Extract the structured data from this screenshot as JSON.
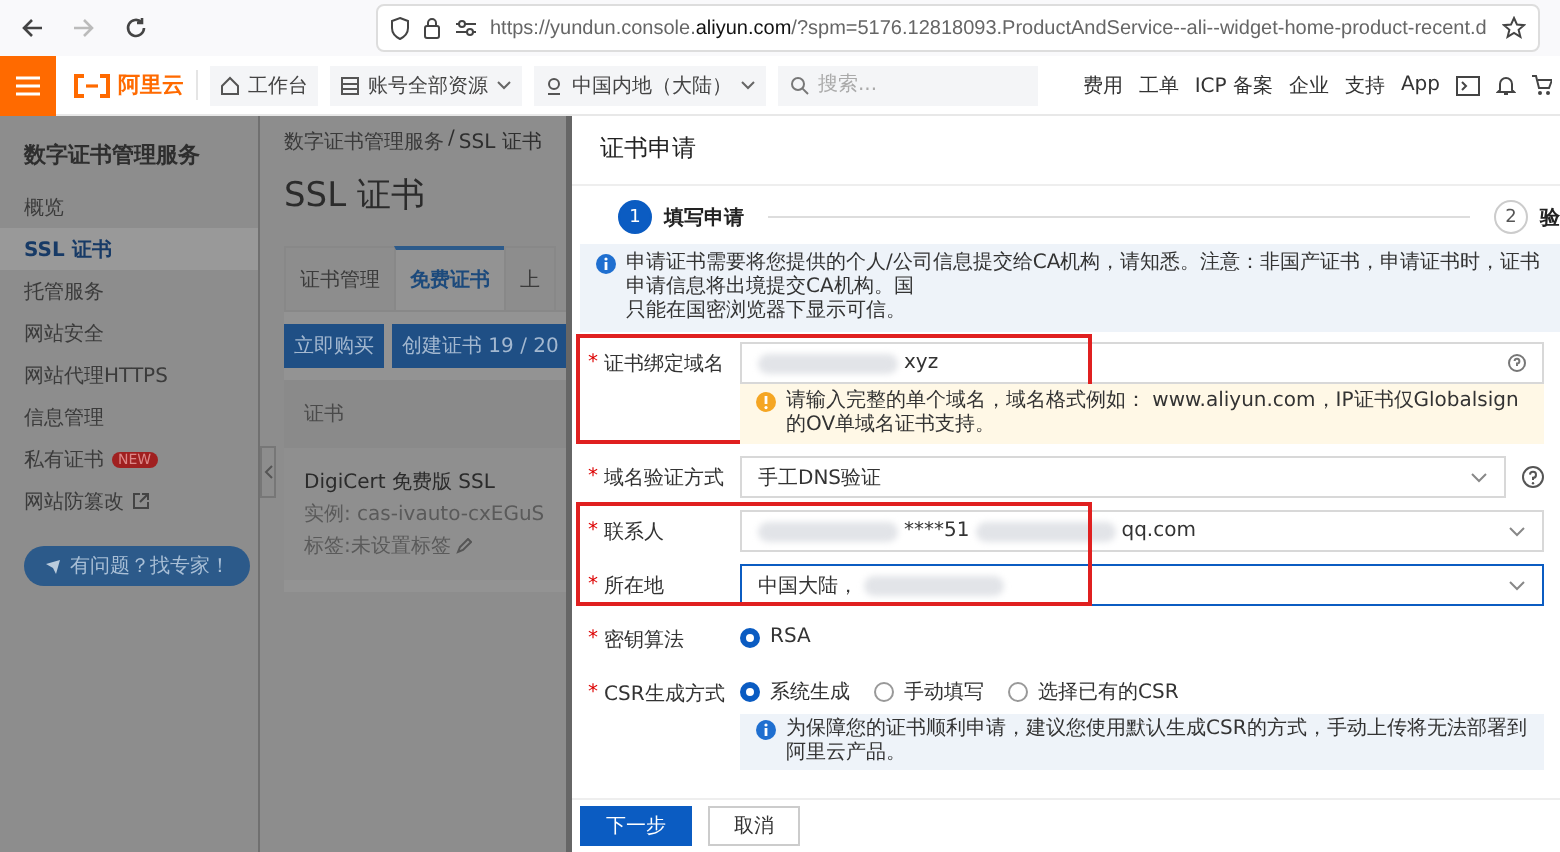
{
  "browser": {
    "url": "https://yundun.console.**aliyun.com**/?spm=5176.12818093.ProductAndService--ali--widget-home-product-recent.d"
  },
  "topnav": {
    "logo": "阿里云",
    "workbench": "工作台",
    "account": "账号全部资源",
    "region": "中国内地（大陆）",
    "search": {
      "placeholder": "搜索..."
    },
    "links": [
      "费用",
      "工单",
      "ICP 备案",
      "企业",
      "支持",
      "App"
    ]
  },
  "sidebar": {
    "title": "数字证书管理服务",
    "items": [
      {
        "label": "概览",
        "selected": false,
        "external": false
      },
      {
        "label": "SSL 证书",
        "selected": true,
        "external": false
      },
      {
        "label": "托管服务",
        "selected": false,
        "external": false
      },
      {
        "label": "网站安全",
        "selected": false,
        "external": false
      },
      {
        "label": "网站代理HTTPS",
        "selected": false,
        "external": false
      },
      {
        "label": "信息管理",
        "selected": false,
        "external": false
      },
      {
        "label": "私有证书",
        "selected": false,
        "external": false,
        "badge": "NEW"
      },
      {
        "label": "网站防篡改",
        "selected": false,
        "external": true
      }
    ],
    "help_button": "有问题？找专家！"
  },
  "main": {
    "breadcrumb": [
      "数字证书管理服务",
      "SSL 证书"
    ],
    "breadcrumb_separator": "/",
    "title": "SSL 证书",
    "tabs": [
      {
        "label": "证书管理",
        "selected": false
      },
      {
        "label": "免费证书",
        "selected": true
      },
      {
        "label": "上",
        "selected": false
      }
    ],
    "buttons": [
      "立即购买",
      "创建证书 19 / 20"
    ],
    "table": {
      "columns": [
        "证书"
      ],
      "rows": [
        {
          "name": "DigiCert 免费版 SSL",
          "instance": "实例: cas-ivauto-cxEGuS",
          "tags": "标签:未设置标签"
        }
      ]
    }
  },
  "drawer": {
    "title": "证书申请",
    "steps": [
      {
        "number": "1",
        "label": "填写申请",
        "selected": true
      },
      {
        "number": "2",
        "label": "验",
        "selected": false
      }
    ],
    "notice": [
      "申请证书需要将您提供的个人/公司信息提交给CA机构，请知悉。注意：非国产证书，申请证书时，证书申请信息将出境提交CA机构。国",
      "只能在国密浏览器下显示可信。"
    ],
    "fields": [
      {
        "kind": "input",
        "mark": "*",
        "label": "证书绑定域名",
        "highlighted": true,
        "focused": false,
        "help": true,
        "value": [
          {
            "kind": "blur"
          },
          {
            "kind": "text",
            "text": "xyz"
          }
        ],
        "hint": "请输入完整的单个域名，域名格式例如： www.aliyun.com，IP证书仅Globalsign的OV单域名证书支持。"
      },
      {
        "kind": "select",
        "mark": "*",
        "label": "域名验证方式",
        "highlighted": false,
        "focused": false,
        "help": true,
        "value": [
          {
            "kind": "text",
            "text": "手工DNS验证"
          }
        ]
      },
      {
        "kind": "select",
        "mark": "*",
        "label": "联系人",
        "highlighted": true,
        "focused": false,
        "help": false,
        "value": [
          {
            "kind": "blur"
          },
          {
            "kind": "text",
            "text": "****51"
          },
          {
            "kind": "blur"
          },
          {
            "kind": "text",
            "text": "qq.com"
          }
        ]
      },
      {
        "kind": "select",
        "mark": "*",
        "label": "所在地",
        "highlighted": true,
        "focused": true,
        "help": false,
        "value": [
          {
            "kind": "text",
            "text": "中国大陆，"
          },
          {
            "kind": "blur"
          }
        ]
      },
      {
        "kind": "radio",
        "mark": "*",
        "label": "密钥算法",
        "highlighted": false,
        "options": [
          {
            "label": "RSA",
            "selected": true
          }
        ]
      },
      {
        "kind": "radio",
        "mark": "*",
        "label": "CSR生成方式",
        "highlighted": false,
        "options": [
          {
            "label": "系统生成",
            "selected": true
          },
          {
            "label": "手动填写",
            "selected": false
          },
          {
            "label": "选择已有的CSR",
            "selected": false
          }
        ],
        "note": "为保障您的证书顺利申请，建议您使用默认生成CSR的方式，手动上传将无法部署到阿里云产品。"
      }
    ],
    "buttons": [
      {
        "label": "下一步",
        "kind": "primary"
      },
      {
        "label": "取消",
        "kind": "secondary"
      }
    ]
  }
}
